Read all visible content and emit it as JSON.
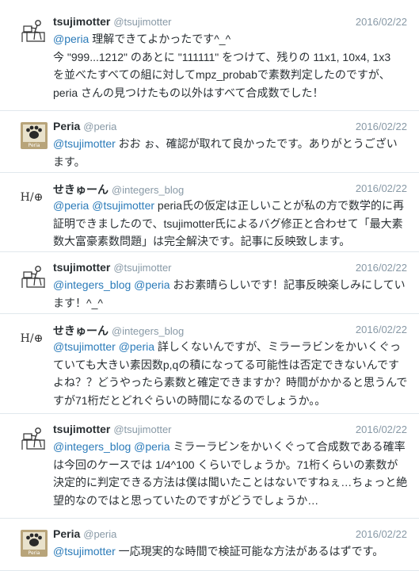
{
  "tweets": [
    {
      "name": "tsujimotter",
      "handle": "@tsujimotter",
      "date": "2016/02/22",
      "avatar": "figure-at-desk-icon",
      "lines": [
        [
          {
            "t": "@peria",
            "m": true
          },
          {
            "t": " 理解できてよかったです^_^"
          }
        ],
        [
          {
            "t": "今 \"999...1212\" のあとに \"111111\" をつけて、残りの 11x1, 10x4, 1x3"
          }
        ],
        [
          {
            "t": "を並べたすべての組に対してmpz_probabで素数判定したのですが、"
          }
        ],
        [
          {
            "t": "peria さんの見つけたもの以外はすべて合成数でした！"
          }
        ]
      ]
    },
    {
      "name": "Peria",
      "handle": "@peria",
      "date": "2016/02/22",
      "avatar": "paw-print-icon",
      "avatar_label": "Peria",
      "lines": [
        [
          {
            "t": "@tsujimotter",
            "m": true
          },
          {
            "t": " おお ぉ、確認が取れて良かったです。ありがとうござい"
          }
        ],
        [
          {
            "t": "ます。"
          }
        ]
      ]
    },
    {
      "name": "せきゅーん",
      "handle": "@integers_blog",
      "date": "2016/02/22",
      "avatar": "logo-text-icon",
      "avatar_label": "H/⊕",
      "lines": [
        [
          {
            "t": "@peria",
            "m": true
          },
          {
            "t": " "
          },
          {
            "t": "@tsujimotter",
            "m": true
          },
          {
            "t": " peria氏の仮定は正しいことが私の方で数学的に再"
          }
        ],
        [
          {
            "t": "証明できましたので、tsujimotter氏によるバグ修正と合わせて「最大素"
          }
        ],
        [
          {
            "t": "数大富豪素数問題」は完全解決です。記事に反映致します。"
          }
        ]
      ]
    },
    {
      "name": "tsujimotter",
      "handle": "@tsujimotter",
      "date": "2016/02/22",
      "avatar": "figure-at-desk-icon",
      "lines": [
        [
          {
            "t": "@integers_blog",
            "m": true
          },
          {
            "t": " "
          },
          {
            "t": "@peria",
            "m": true
          },
          {
            "t": " おお素晴らしいです！記事反映楽しみにしてい"
          }
        ],
        [
          {
            "t": "ます！^_^"
          }
        ]
      ]
    },
    {
      "name": "せきゅーん",
      "handle": "@integers_blog",
      "date": "2016/02/22",
      "avatar": "logo-text-icon",
      "avatar_label": "H/⊕",
      "lines": [
        [
          {
            "t": "@tsujimotter",
            "m": true
          },
          {
            "t": " "
          },
          {
            "t": "@peria",
            "m": true
          },
          {
            "t": " 詳しくないんですが、ミラーラビンをかいくぐっ"
          }
        ],
        [
          {
            "t": "ていても大きい素因数p,qの積になってる可能性は否定できないんです"
          }
        ],
        [
          {
            "t": "よね？？どうやったら素数と確定できますか？時間がかかると思うんで"
          }
        ],
        [
          {
            "t": "すが71桁だとどれぐらいの時間になるのでしょうか。。"
          }
        ]
      ]
    },
    {
      "name": "tsujimotter",
      "handle": "@tsujimotter",
      "date": "2016/02/22",
      "avatar": "figure-at-desk-icon",
      "lines": [
        [
          {
            "t": "@integers_blog",
            "m": true
          },
          {
            "t": " "
          },
          {
            "t": "@peria",
            "m": true
          },
          {
            "t": " ミラーラビンをかいくぐって合成数である確率"
          }
        ],
        [
          {
            "t": "は今回のケースでは 1/4^100 くらいでしょうか。71桁くらいの素数が"
          }
        ],
        [
          {
            "t": "決定的に判定できる方法は僕は聞いたことはないですねぇ…ちょっと絶"
          }
        ],
        [
          {
            "t": "望的なのではと思っていたのですがどうでしょうか…"
          }
        ]
      ]
    },
    {
      "name": "Peria",
      "handle": "@peria",
      "date": "2016/02/22",
      "avatar": "paw-print-icon",
      "avatar_label": "Peria",
      "lines": [
        [
          {
            "t": "@tsujimotter",
            "m": true
          },
          {
            "t": " 一応現実的な時間で検証可能な方法があるはずです。"
          }
        ]
      ]
    }
  ]
}
